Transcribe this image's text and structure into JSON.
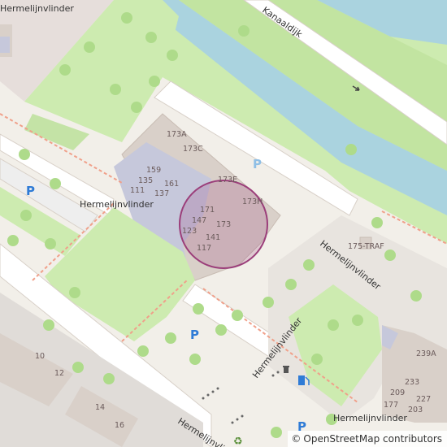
{
  "map": {
    "streets": [
      "Hermelijnvlinder",
      "Kanaaldijk"
    ],
    "house_numbers": [
      "173A",
      "173C",
      "159",
      "135",
      "161",
      "111",
      "137",
      "173E",
      "173H",
      "171",
      "147",
      "173",
      "123",
      "141",
      "117",
      "175-TRAF",
      "10",
      "12",
      "14",
      "16",
      "239A",
      "233",
      "209",
      "227",
      "177",
      "203"
    ],
    "parking_label": "P",
    "marker": {
      "shape": "circle",
      "color": "#9b3e7a"
    },
    "colors": {
      "water": "#aad3df",
      "grass": "#c8e8a7",
      "building": "#d9d0c9",
      "road": "#ffffff",
      "highlight": "#c9b3c8"
    }
  },
  "attribution": {
    "symbol": "©",
    "text": "OpenStreetMap contributors"
  }
}
